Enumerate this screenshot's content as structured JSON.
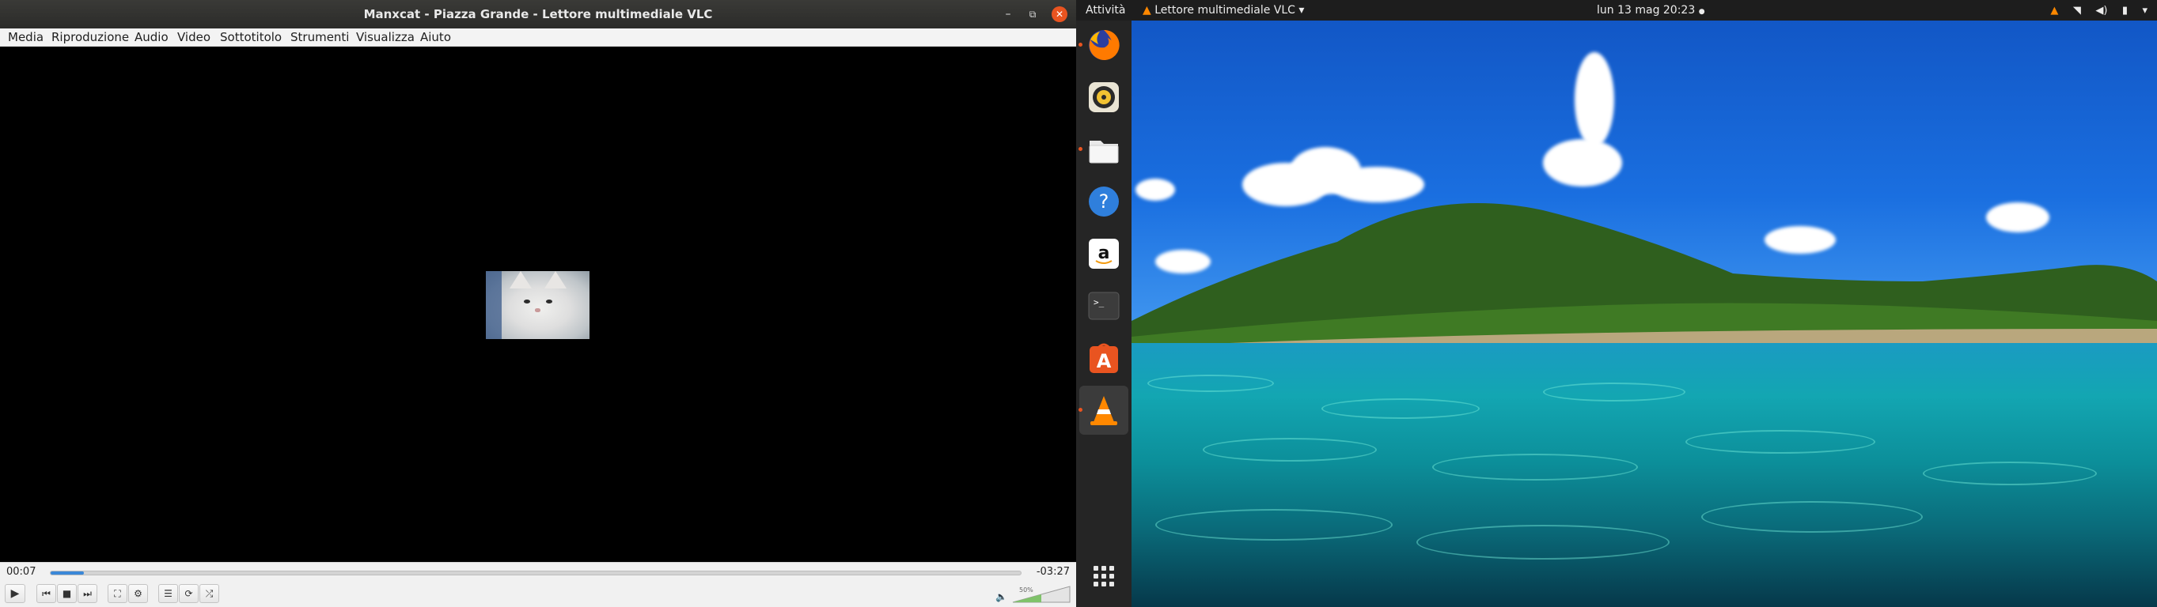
{
  "vlc": {
    "title": "Manxcat - Piazza Grande - Lettore multimediale VLC",
    "window_buttons": {
      "minimize": "–",
      "restore": "⧉",
      "close": "✕"
    },
    "menu": [
      "Media",
      "Riproduzione",
      "Audio",
      "Video",
      "Sottotitolo",
      "Strumenti",
      "Visualizza",
      "Aiuto"
    ],
    "time_elapsed": "00:07",
    "time_remaining": "-03:27",
    "progress": 0.034,
    "volume_label": "50%",
    "volume_level": 0.5,
    "controls": {
      "play": "▶",
      "prev": "⏮",
      "stop": "■",
      "next": "⏭",
      "fullscreen": "⛶",
      "extended": "⚙",
      "playlist": "☰",
      "loop": "⟳",
      "random": "⤮"
    },
    "volume_icon": "🔈"
  },
  "topbar": {
    "activities": "Attività",
    "app_menu": "Lettore multimediale VLC",
    "app_menu_arrow": "▾",
    "clock": "lun 13 mag  20:23",
    "tray": [
      "vlc-icon",
      "wifi-icon",
      "volume-icon",
      "battery-icon",
      "power-menu-icon"
    ]
  },
  "dock": {
    "items": [
      {
        "name": "firefox-icon",
        "color": "#e66000",
        "running": true
      },
      {
        "name": "rhythmbox-icon",
        "color": "#e8e2d0",
        "running": false
      },
      {
        "name": "files-icon",
        "color": "#efefef",
        "running": true
      },
      {
        "name": "help-icon",
        "color": "#2e7de0",
        "running": false
      },
      {
        "name": "amazon-icon",
        "color": "#ffffff",
        "running": false
      },
      {
        "name": "terminal-icon",
        "color": "#3a3a3a",
        "running": false
      },
      {
        "name": "software-icon",
        "color": "#e95420",
        "running": false
      },
      {
        "name": "vlc-icon",
        "color": "#ff8800",
        "running": true
      }
    ]
  }
}
